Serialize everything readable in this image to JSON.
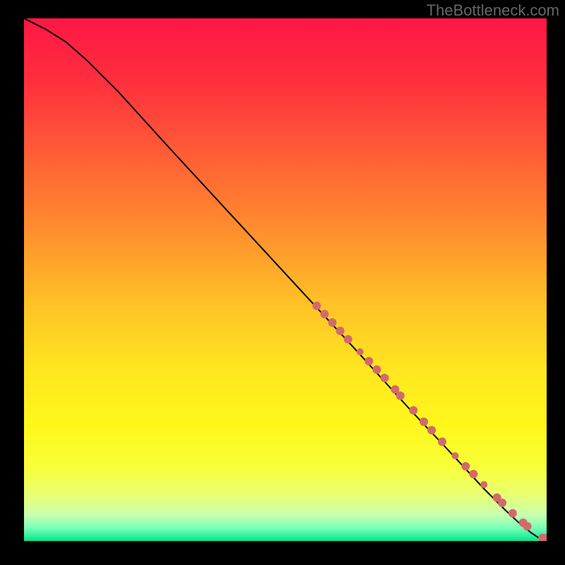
{
  "watermark": "TheBottleneck.com",
  "gradient": {
    "stops": [
      {
        "offset": 0.0,
        "color": "#ff1744"
      },
      {
        "offset": 0.12,
        "color": "#ff2f3e"
      },
      {
        "offset": 0.25,
        "color": "#ff5a36"
      },
      {
        "offset": 0.4,
        "color": "#ff8c2e"
      },
      {
        "offset": 0.55,
        "color": "#ffc326"
      },
      {
        "offset": 0.68,
        "color": "#ffe81f"
      },
      {
        "offset": 0.78,
        "color": "#fff71a"
      },
      {
        "offset": 0.86,
        "color": "#f8ff3a"
      },
      {
        "offset": 0.91,
        "color": "#eaff70"
      },
      {
        "offset": 0.95,
        "color": "#c8ffb0"
      },
      {
        "offset": 0.975,
        "color": "#7affb8"
      },
      {
        "offset": 1.0,
        "color": "#00e68c"
      }
    ]
  },
  "curve_color": "#000000",
  "marker_color": "#d26a6a",
  "chart_data": {
    "type": "line",
    "title": "",
    "xlabel": "",
    "ylabel": "",
    "xlim": [
      0,
      100
    ],
    "ylim": [
      0,
      100
    ],
    "series": [
      {
        "name": "curve",
        "x": [
          0,
          4,
          8,
          12,
          18,
          28,
          40,
          52,
          64,
          74,
          82,
          88,
          92,
          95,
          97,
          98.5,
          100
        ],
        "y": [
          100,
          98,
          95.5,
          92,
          86,
          75,
          62,
          49,
          36,
          25,
          16.5,
          10,
          6,
          3.2,
          1.6,
          0.6,
          0.3
        ]
      }
    ],
    "markers": [
      {
        "x": 56.0,
        "y": 45.0,
        "r": 6
      },
      {
        "x": 57.5,
        "y": 43.4,
        "r": 6
      },
      {
        "x": 59.0,
        "y": 41.8,
        "r": 6
      },
      {
        "x": 60.5,
        "y": 40.2,
        "r": 6
      },
      {
        "x": 62.0,
        "y": 38.6,
        "r": 6
      },
      {
        "x": 64.3,
        "y": 36.2,
        "r": 5
      },
      {
        "x": 66.0,
        "y": 34.4,
        "r": 6
      },
      {
        "x": 67.5,
        "y": 32.8,
        "r": 6
      },
      {
        "x": 69.0,
        "y": 31.2,
        "r": 6
      },
      {
        "x": 71.0,
        "y": 29.0,
        "r": 6
      },
      {
        "x": 72.0,
        "y": 27.8,
        "r": 6
      },
      {
        "x": 74.5,
        "y": 25.0,
        "r": 6
      },
      {
        "x": 76.5,
        "y": 22.8,
        "r": 6
      },
      {
        "x": 78.0,
        "y": 21.2,
        "r": 6
      },
      {
        "x": 80.0,
        "y": 19.0,
        "r": 6
      },
      {
        "x": 82.5,
        "y": 16.3,
        "r": 5
      },
      {
        "x": 84.5,
        "y": 14.3,
        "r": 6
      },
      {
        "x": 86.0,
        "y": 12.8,
        "r": 6
      },
      {
        "x": 88.0,
        "y": 10.8,
        "r": 5
      },
      {
        "x": 90.5,
        "y": 8.3,
        "r": 6
      },
      {
        "x": 91.5,
        "y": 7.3,
        "r": 6
      },
      {
        "x": 93.5,
        "y": 5.3,
        "r": 6
      },
      {
        "x": 95.5,
        "y": 3.5,
        "r": 6
      },
      {
        "x": 96.3,
        "y": 2.8,
        "r": 6
      },
      {
        "x": 99.2,
        "y": 0.6,
        "r": 6
      },
      {
        "x": 100.0,
        "y": 0.6,
        "r": 6
      }
    ]
  }
}
